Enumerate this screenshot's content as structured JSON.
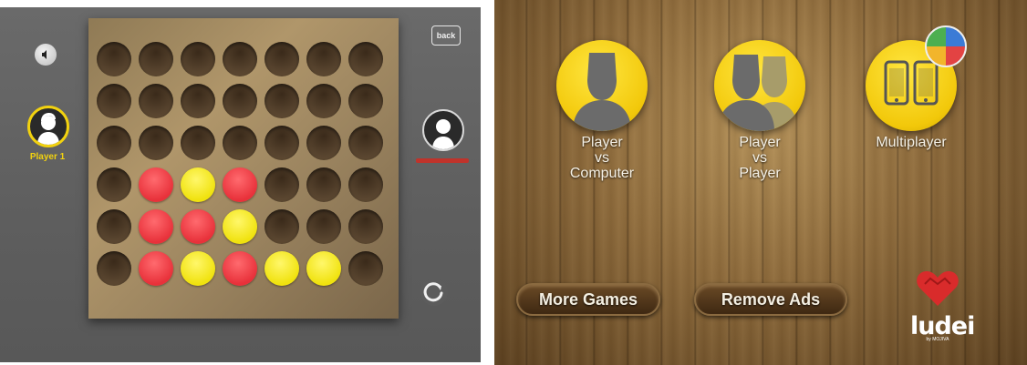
{
  "left_game": {
    "back_label": "back",
    "player1_label": "Player 1",
    "board": [
      [
        "empty",
        "empty",
        "empty",
        "empty",
        "empty",
        "empty",
        "empty"
      ],
      [
        "empty",
        "empty",
        "empty",
        "empty",
        "empty",
        "empty",
        "empty"
      ],
      [
        "empty",
        "empty",
        "empty",
        "empty",
        "empty",
        "empty",
        "empty"
      ],
      [
        "empty",
        "red",
        "yellow",
        "red",
        "empty",
        "empty",
        "empty"
      ],
      [
        "empty",
        "red",
        "red",
        "yellow",
        "empty",
        "empty",
        "empty"
      ],
      [
        "empty",
        "red",
        "yellow",
        "red",
        "yellow",
        "yellow",
        "empty"
      ]
    ],
    "colors": {
      "red": "#e8313a",
      "yellow": "#f0e20e",
      "highlight": "#f2d20f"
    },
    "icons": [
      "speaker-icon",
      "player1-avatar-icon",
      "player2-avatar-icon",
      "reset-icon"
    ]
  },
  "right_menu": {
    "modes": [
      {
        "label": "Player\nvs\nComputer",
        "icon": "single-user-icon"
      },
      {
        "label": "Player\nvs\nPlayer",
        "icon": "two-users-icon"
      },
      {
        "label": "Multiplayer",
        "icon": "phones-icon"
      }
    ],
    "buttons": {
      "more_games": "More Games",
      "remove_ads": "Remove Ads"
    },
    "logo": {
      "word": "ludei",
      "sub": "by MOJIVA"
    }
  }
}
